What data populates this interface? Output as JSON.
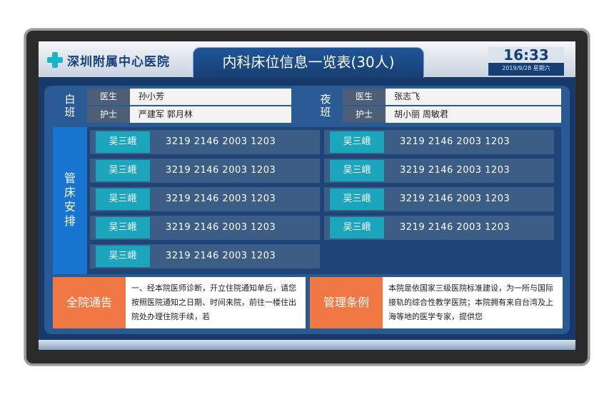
{
  "header": {
    "hospital_name": "深圳附属中心医院",
    "title": "内科床位信息一览表(30人)",
    "time": "16:33",
    "date": "2019/9/28  星期六"
  },
  "shifts": {
    "day": {
      "name": [
        "白",
        "班"
      ],
      "doctor_label": "医生",
      "doctor": "孙小芳",
      "nurse_label": "护士",
      "nurses": "严建军  郭月林"
    },
    "night": {
      "name": [
        "夜",
        "班"
      ],
      "doctor_label": "医生",
      "doctor": "张志飞",
      "nurse_label": "护士",
      "nurses": "胡小丽  周敏君"
    }
  },
  "bed_section": {
    "label": [
      "管",
      "床",
      "安",
      "排"
    ],
    "left": [
      {
        "name": "吴三峨",
        "numbers": "3219  2146  2003  1203"
      },
      {
        "name": "吴三峨",
        "numbers": "3219  2146  2003  1203"
      },
      {
        "name": "吴三峨",
        "numbers": "3219  2146  2003  1203"
      },
      {
        "name": "吴三峨",
        "numbers": "3219  2146  2003  1203"
      },
      {
        "name": "吴三峨",
        "numbers": "3219  2146  2003  1203"
      }
    ],
    "right": [
      {
        "name": "吴三峨",
        "numbers": "3219  2146  2003  1203"
      },
      {
        "name": "吴三峨",
        "numbers": "3219  2146  2003  1203"
      },
      {
        "name": "吴三峨",
        "numbers": "3219  2146  2003  1203"
      },
      {
        "name": "吴三峨",
        "numbers": "3219  2146  2003  1203"
      }
    ]
  },
  "notices": {
    "hospital_notice": {
      "title": "全院通告",
      "body": "一、经本院医师诊断，开立住院通知单后，请您按照医院通知之日期、时间来院，前往一楼住出院处办理住院手续，若"
    },
    "management_rules": {
      "title": "管理条例",
      "body": "本院是依国家三级医院标准建设，为一所与国际接轨的综合性教学医院；本院拥有来自台湾及上海等地的医学专家，提供您"
    }
  },
  "colors": {
    "screen_bg": "#183a6b",
    "accent_teal": "#1ba6bd",
    "accent_orange": "#f07844",
    "bed_label_blue": "#1874d1"
  }
}
